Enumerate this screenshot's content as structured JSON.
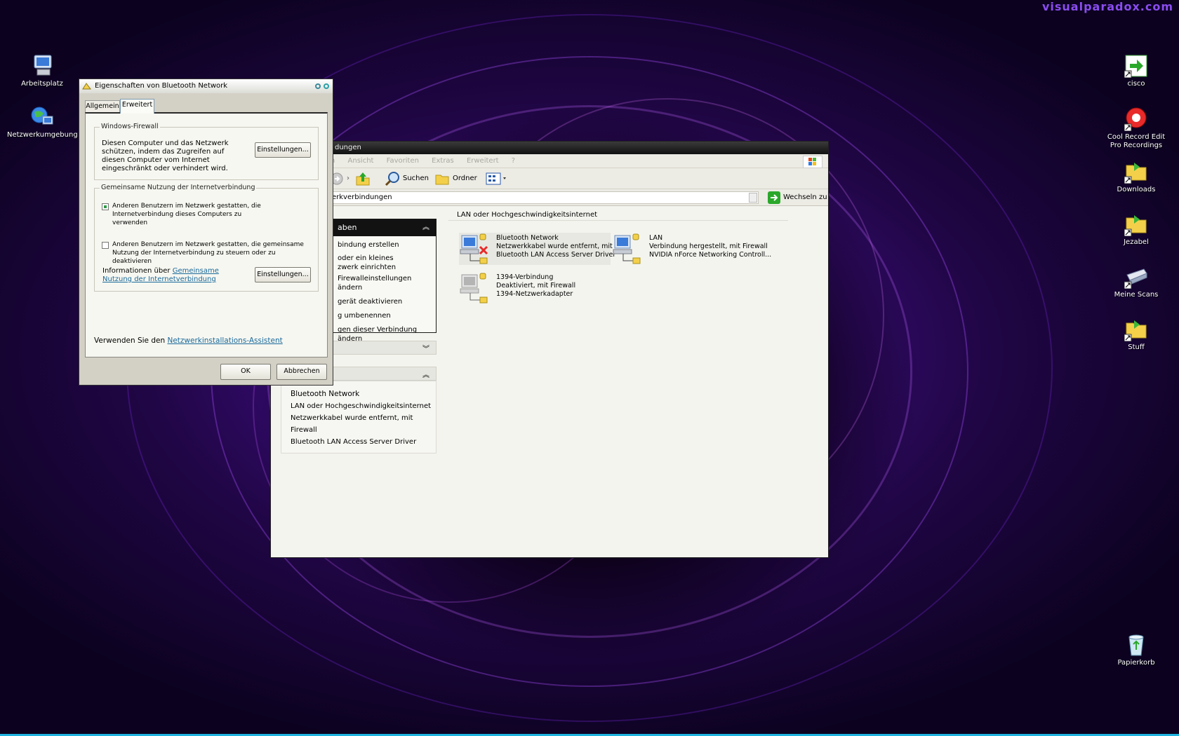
{
  "watermark": "visualparadox.com",
  "desktop": {
    "icons_left": [
      {
        "label": "Arbeitsplatz",
        "icon": "computer-icon"
      },
      {
        "label": "Netzwerkumgebung",
        "icon": "network-places-icon"
      }
    ],
    "icons_right": [
      {
        "label": "cisco",
        "icon": "shortcut-arrow-icon"
      },
      {
        "label": "Cool Record Edit Pro Recordings",
        "icon": "record-icon"
      },
      {
        "label": "Downloads",
        "icon": "folder-shortcut-icon"
      },
      {
        "label": "Jezabel",
        "icon": "folder-shortcut-icon"
      },
      {
        "label": "Meine Scans",
        "icon": "scanner-icon"
      },
      {
        "label": "Stuff",
        "icon": "folder-shortcut-icon"
      },
      {
        "label": "Papierkorb",
        "icon": "recycle-bin-icon"
      }
    ]
  },
  "explorer": {
    "title": "dungen",
    "menu": [
      "n",
      "Ansicht",
      "Favoriten",
      "Extras",
      "Erweitert",
      "?"
    ],
    "toolbar": {
      "search": "Suchen",
      "folders": "Ordner"
    },
    "address": {
      "value": "erkverbindungen",
      "go": "Wechseln zu"
    },
    "tasks": {
      "header": "aben",
      "items": [
        "bindung erstellen",
        "oder ein kleines",
        "zwerk einrichten",
        "Firewalleinstellungen ändern",
        "gerät deaktivieren",
        "g umbenennen",
        "gen dieser Verbindung ändern"
      ]
    },
    "details": [
      "Bluetooth Network",
      "LAN oder Hochgeschwindigkeitsinternet",
      "Netzwerkkabel wurde entfernt, mit Firewall",
      "Bluetooth LAN Access Server Driver"
    ],
    "group_header": "LAN oder Hochgeschwindigkeitsinternet",
    "connections": [
      {
        "name": "Bluetooth Network",
        "status": "Netzwerkkabel wurde entfernt, mit ...",
        "device": "Bluetooth LAN Access Server Driver"
      },
      {
        "name": "LAN",
        "status": "Verbindung hergestellt, mit Firewall",
        "device": "NVIDIA nForce Networking Controll..."
      },
      {
        "name": "1394-Verbindung",
        "status": "Deaktiviert, mit Firewall",
        "device": "1394-Netzwerkadapter"
      }
    ]
  },
  "dialog": {
    "title": "Eigenschaften von Bluetooth Network",
    "tabs": [
      "Allgemein",
      "Erweitert"
    ],
    "firewall": {
      "legend": "Windows-Firewall",
      "text": "Diesen Computer und das Netzwerk schützen, indem das Zugreifen auf diesen Computer vom Internet eingeschränkt oder verhindert wird.",
      "button": "Einstellungen..."
    },
    "ics": {
      "legend": "Gemeinsame Nutzung der Internetverbindung",
      "cb1": "Anderen Benutzern im Netzwerk gestatten, die Internetverbindung dieses Computers zu verwenden",
      "cb1_checked": true,
      "cb2": "Anderen Benutzern im Netzwerk gestatten, die gemeinsame Nutzung der Internetverbindung zu steuern oder zu deaktivieren",
      "cb2_checked": false,
      "info_prefix": "Informationen über",
      "info_link": "Gemeinsame Nutzung der Internetverbindung",
      "button": "Einstellungen..."
    },
    "wizard_prefix": "Verwenden Sie den",
    "wizard_link": "Netzwerkinstallations-Assistent",
    "ok": "OK",
    "cancel": "Abbrechen"
  }
}
